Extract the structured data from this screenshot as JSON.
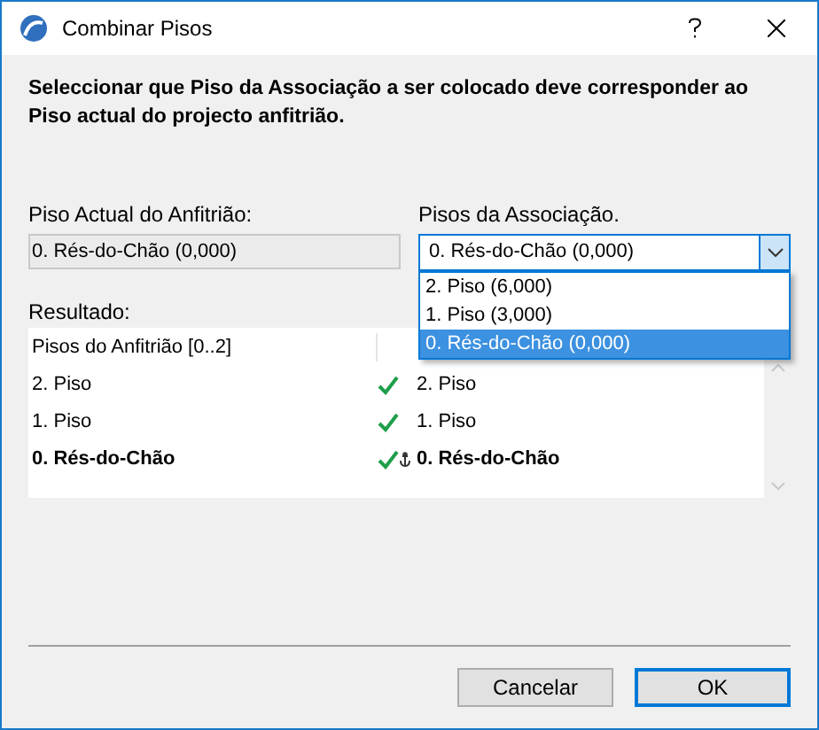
{
  "window": {
    "title": "Combinar Pisos"
  },
  "description": "Seleccionar que Piso da Associação a ser colocado deve corresponder ao Piso actual do projecto anfitrião.",
  "host_story": {
    "label": "Piso Actual do Anfitrião:",
    "value": "0. Rés-do-Chão (0,000)"
  },
  "association_story": {
    "label": "Pisos da Associação.",
    "value": "0. Rés-do-Chão (0,000)",
    "expanded": true,
    "options": [
      {
        "label": "2. Piso (6,000)",
        "selected": false
      },
      {
        "label": "1. Piso (3,000)",
        "selected": false
      },
      {
        "label": "0. Rés-do-Chão (0,000)",
        "selected": true
      }
    ]
  },
  "result": {
    "label": "Resultado:",
    "columns": [
      "Pisos do Anfitrião [0..2]"
    ],
    "rows": [
      {
        "host": "2. Piso",
        "association": "2. Piso",
        "matched": true,
        "anchor": false,
        "bold": false
      },
      {
        "host": "1. Piso",
        "association": "1. Piso",
        "matched": true,
        "anchor": false,
        "bold": false
      },
      {
        "host": "0. Rés-do-Chão",
        "association": "0. Rés-do-Chão",
        "matched": true,
        "anchor": true,
        "bold": true
      }
    ]
  },
  "buttons": [
    {
      "label": "Cancelar",
      "default": false
    },
    {
      "label": "OK",
      "default": true
    }
  ]
}
